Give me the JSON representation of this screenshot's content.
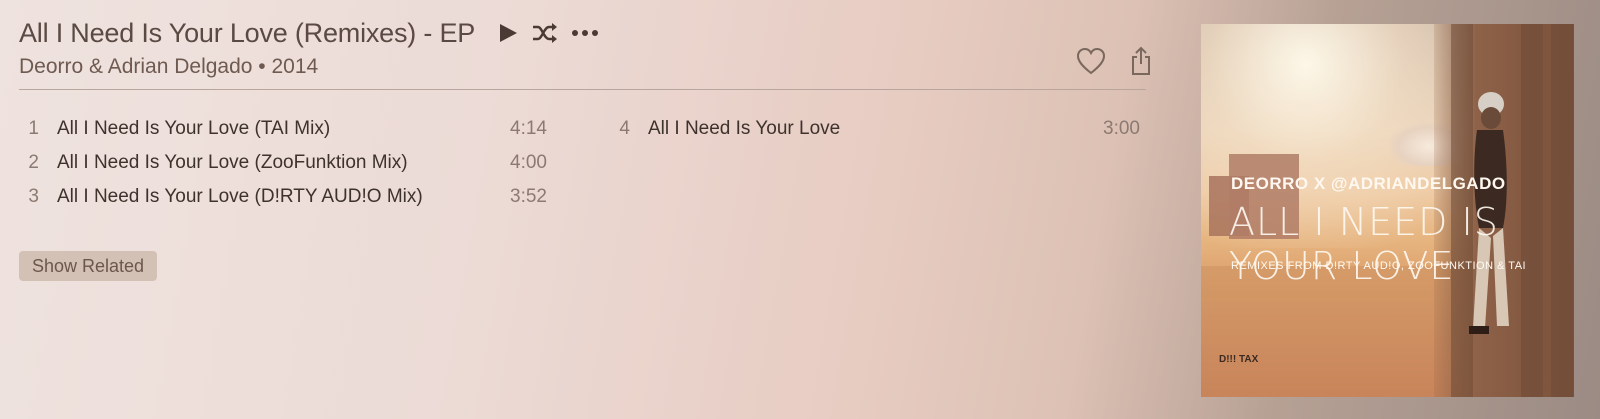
{
  "album": {
    "title": "All I Need Is Your Love (Remixes) - EP",
    "artist_year": "Deorro & Adrian Delgado • 2014"
  },
  "controls": {
    "play_icon": "play-icon",
    "shuffle_icon": "shuffle-icon",
    "more_icon": "more-icon",
    "love_icon": "heart-icon",
    "share_icon": "share-icon"
  },
  "tracks_left": [
    {
      "num": "1",
      "name": "All I Need Is Your Love (TAI Mix)",
      "duration": "4:14"
    },
    {
      "num": "2",
      "name": "All I Need Is Your Love (ZooFunktion Mix)",
      "duration": "4:00"
    },
    {
      "num": "3",
      "name": "All I Need Is Your Love (D!RTY AUD!O Mix)",
      "duration": "3:52"
    }
  ],
  "tracks_right": [
    {
      "num": "4",
      "name": "All I Need Is Your Love",
      "duration": "3:00"
    }
  ],
  "show_related_label": "Show Related",
  "artwork": {
    "line1": "DEORRO X @ADRIANDELGADO",
    "line2": "ALL I NEED IS YOUR LOVE",
    "line3": "REMIXES FROM D!RTY AUD!O, ZOOFUNKTION & TAI",
    "logo": "D!!! TAX"
  },
  "colors": {
    "title": "#5a4a43",
    "track_text": "#3e322c",
    "muted": "#8c7a72",
    "button_bg": "#d4c1b5"
  }
}
